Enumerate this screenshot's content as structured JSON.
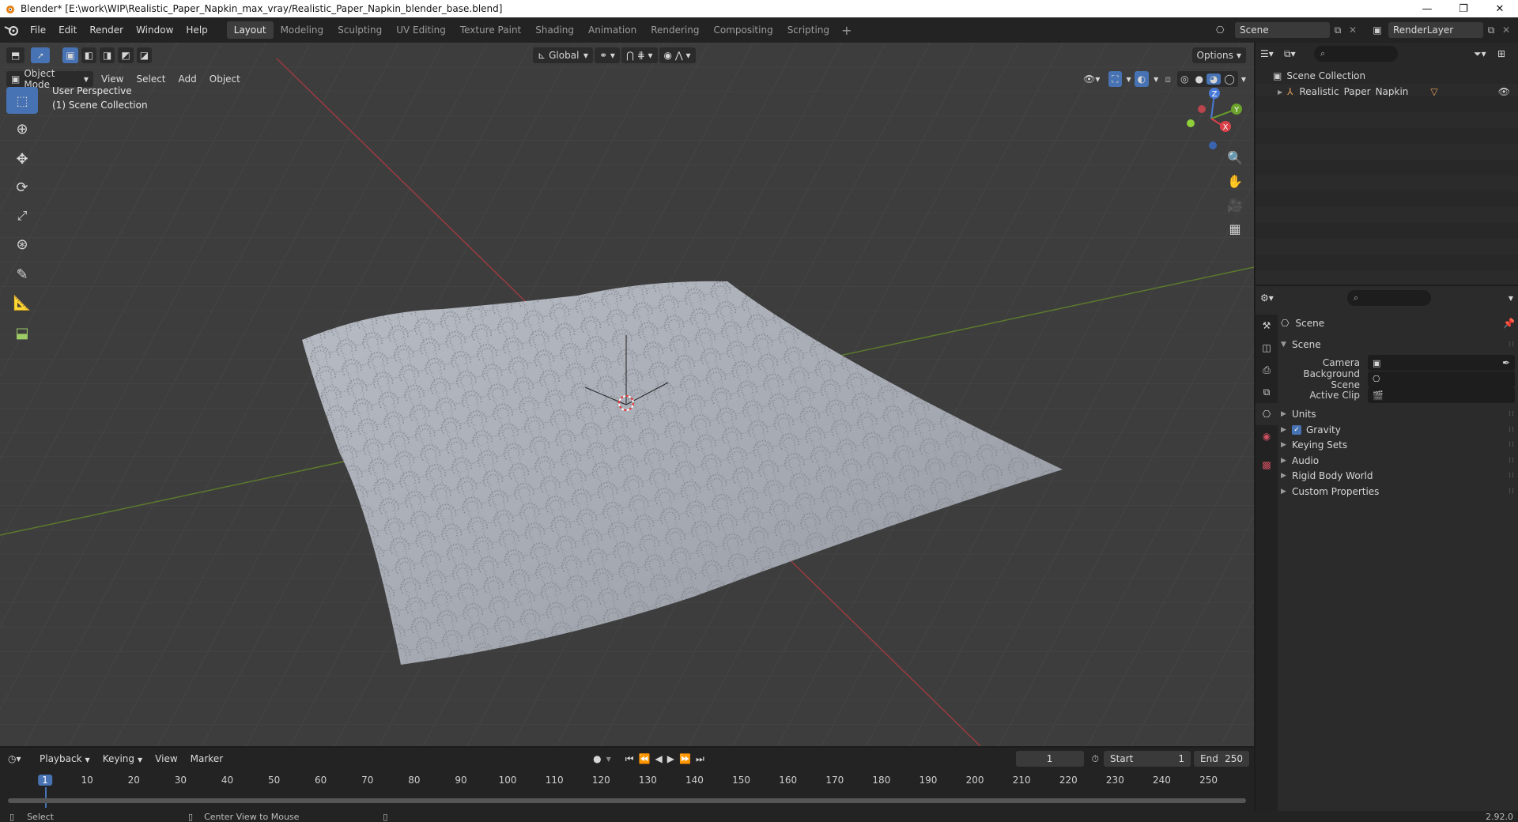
{
  "window": {
    "title": "Blender* [E:\\work\\WIP\\Realistic_Paper_Napkin_max_vray/Realistic_Paper_Napkin_blender_base.blend]",
    "minimize": "—",
    "restore": "❐",
    "close": "✕"
  },
  "menu": [
    "File",
    "Edit",
    "Render",
    "Window",
    "Help"
  ],
  "workspaces": [
    "Layout",
    "Modeling",
    "Sculpting",
    "UV Editing",
    "Texture Paint",
    "Shading",
    "Animation",
    "Rendering",
    "Compositing",
    "Scripting"
  ],
  "workspace_active": "Layout",
  "scene_name": "Scene",
  "view_layer": "RenderLayer",
  "viewport": {
    "mode": "Object Mode",
    "menus": [
      "View",
      "Select",
      "Add",
      "Object"
    ],
    "transform_orientation": "Global",
    "options_label": "Options",
    "perspective_label": "User Perspective",
    "collection_label": "(1) Scene Collection",
    "gizmo_x": "X",
    "gizmo_y": "Y",
    "gizmo_z": "Z"
  },
  "outliner": {
    "root": "Scene Collection",
    "items": [
      {
        "label": "Realistic_Paper_Napkin"
      }
    ]
  },
  "properties": {
    "context_title": "Scene",
    "panel_title": "Scene",
    "fields": [
      {
        "label": "Camera",
        "value": ""
      },
      {
        "label": "Background Scene",
        "value": ""
      },
      {
        "label": "Active Clip",
        "value": ""
      }
    ],
    "subpanels": [
      {
        "label": "Units",
        "checkbox": false
      },
      {
        "label": "Gravity",
        "checkbox": true
      },
      {
        "label": "Keying Sets",
        "checkbox": false
      },
      {
        "label": "Audio",
        "checkbox": false
      },
      {
        "label": "Rigid Body World",
        "checkbox": false
      },
      {
        "label": "Custom Properties",
        "checkbox": false
      }
    ]
  },
  "timeline": {
    "menus": [
      "Playback",
      "Keying",
      "View",
      "Marker"
    ],
    "current_frame": "1",
    "start_label": "Start",
    "start_value": "1",
    "end_label": "End",
    "end_value": "250",
    "ruler": [
      "1",
      "10",
      "20",
      "30",
      "40",
      "50",
      "60",
      "70",
      "80",
      "90",
      "100",
      "110",
      "120",
      "130",
      "140",
      "150",
      "160",
      "170",
      "180",
      "190",
      "200",
      "210",
      "220",
      "230",
      "240",
      "250"
    ]
  },
  "status": {
    "left_action": "Select",
    "middle_action": "Center View to Mouse",
    "version": "2.92.0"
  },
  "colors": {
    "accent": "#4772b3",
    "axis_x": "#c7363f",
    "axis_y": "#5c8d1c",
    "napkin": "#a9adb6"
  }
}
